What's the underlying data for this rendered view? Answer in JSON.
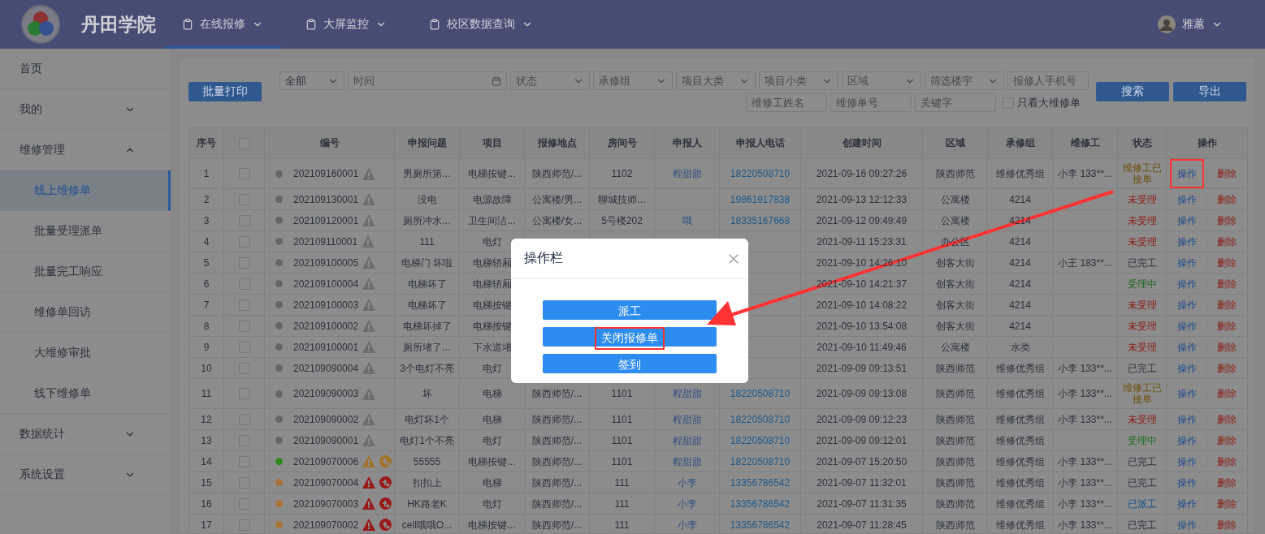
{
  "header": {
    "title": "丹田学院",
    "nav": [
      {
        "label": "在线报修",
        "selected": true
      },
      {
        "label": "大屏监控",
        "selected": false
      },
      {
        "label": "校区数据查询",
        "selected": false
      }
    ],
    "user": "雅蕙"
  },
  "sidebar": [
    {
      "label": "首页",
      "selected": false
    },
    {
      "label": "我的",
      "selected": false,
      "expanded": false
    },
    {
      "label": "维修管理",
      "selected": false,
      "expanded": true,
      "children": [
        {
          "label": "线上维修单",
          "selected": true
        },
        {
          "label": "批量受理派单",
          "selected": false
        },
        {
          "label": "批量完工响应",
          "selected": false
        },
        {
          "label": "维修单回访",
          "selected": false
        },
        {
          "label": "大维修审批",
          "selected": false
        },
        {
          "label": "线下维修单",
          "selected": false
        }
      ]
    },
    {
      "label": "数据统计",
      "selected": false,
      "expanded": false
    },
    {
      "label": "系统设置",
      "selected": false,
      "expanded": false
    }
  ],
  "toolbar": {
    "print_button": "批量打印",
    "filters": [
      {
        "kind": "select",
        "value": "全部"
      },
      {
        "kind": "date",
        "placeholder": "时间"
      },
      {
        "kind": "select",
        "placeholder": "状态"
      },
      {
        "kind": "select",
        "placeholder": "承修组"
      },
      {
        "kind": "select",
        "placeholder": "项目大类"
      },
      {
        "kind": "select",
        "placeholder": "项目小类"
      },
      {
        "kind": "select",
        "placeholder": "区域"
      },
      {
        "kind": "select",
        "placeholder": "筛选楼宇"
      },
      {
        "kind": "input",
        "placeholder": "报修人手机号"
      },
      {
        "kind": "input",
        "placeholder": "维修工姓名"
      },
      {
        "kind": "input",
        "placeholder": "维修单号"
      },
      {
        "kind": "input",
        "placeholder": "关键字"
      },
      {
        "kind": "checkbox",
        "label": "只看大维修单",
        "checked": false
      }
    ],
    "search_button": "搜索",
    "export_button": "导出"
  },
  "table": {
    "columns": [
      {
        "label": "序号"
      },
      {
        "kind": "checkbox",
        "checked": false
      },
      {
        "label": "编号"
      },
      {
        "label": "申报问题"
      },
      {
        "label": "项目"
      },
      {
        "label": "报修地点"
      },
      {
        "label": "房间号"
      },
      {
        "label": "申报人"
      },
      {
        "label": "申报人电话"
      },
      {
        "label": "创建时间"
      },
      {
        "label": "区域"
      },
      {
        "label": "承修组"
      },
      {
        "label": "维修工"
      },
      {
        "label": "状态"
      },
      {
        "label": "操作"
      }
    ],
    "rows": [
      {
        "no": "1",
        "checked": false,
        "dot": {
          "color": "#666666"
        },
        "code": "202109160001",
        "warning": {
          "color": "#6e6e6e"
        },
        "problem": "男厕所第...",
        "project": "电梯按键...",
        "location": "陕西师范/...",
        "room": "1102",
        "reporter": "程甜甜",
        "phone": "18220508710",
        "created": "2021-09-16 09:27:26",
        "area": "陕西师范",
        "group": "维修优秀组",
        "worker": "小李 133**...",
        "status": {
          "label": "维修工已接单",
          "color": "#6e4e0a"
        },
        "action": "操作",
        "action_highlighted": true,
        "delete": "删除"
      },
      {
        "no": "2",
        "checked": false,
        "dot": {
          "color": "#666666"
        },
        "code": "202109130001",
        "warning": {
          "color": "#6e6e6e"
        },
        "problem": "没电",
        "project": "电源故障",
        "location": "公寓楼/男...",
        "room": "聊城技师...",
        "phone": "19861917838",
        "created": "2021-09-13 12:12:33",
        "area": "公寓楼",
        "group": "4214",
        "status": {
          "label": "未受理",
          "color": "#8c1a14"
        },
        "action": "操作",
        "action_highlighted": false,
        "delete": "删除"
      },
      {
        "no": "3",
        "checked": false,
        "dot": {
          "color": "#666666"
        },
        "code": "202109120001",
        "warning": {
          "color": "#6e6e6e"
        },
        "problem": "厕所冲水...",
        "project": "卫生间洁...",
        "location": "公寓楼/女...",
        "room": "5号楼202",
        "reporter": "哦",
        "phone": "18335167668",
        "created": "2021-09-12 09:49:49",
        "area": "公寓楼",
        "group": "4214",
        "status": {
          "label": "未受理",
          "color": "#8c1a14"
        },
        "action": "操作",
        "action_highlighted": false,
        "delete": "删除"
      },
      {
        "no": "4",
        "checked": false,
        "dot": {
          "color": "#666666"
        },
        "code": "202109110001",
        "warning": {
          "color": "#6e6e6e"
        },
        "problem": "111",
        "project": "电灯",
        "created": "2021-09-11 15:23:31",
        "area": "办公区",
        "group": "4214",
        "status": {
          "label": "未受理",
          "color": "#8c1a14"
        },
        "action": "操作",
        "action_highlighted": false,
        "delete": "删除"
      },
      {
        "no": "5",
        "checked": false,
        "dot": {
          "color": "#666666"
        },
        "code": "202109100005",
        "warning": {
          "color": "#6e6e6e"
        },
        "problem": "电梯门 坏啦",
        "project": "电梯轿厢",
        "created": "2021-09-10 14:26:10",
        "area": "创客大街",
        "group": "4214",
        "worker": "小王 183**...",
        "status": {
          "label": "已完工",
          "color": "#2d313c"
        },
        "action": "操作",
        "action_highlighted": false,
        "delete": "删除"
      },
      {
        "no": "6",
        "checked": false,
        "dot": {
          "color": "#666666"
        },
        "code": "202109100004",
        "warning": {
          "color": "#6e6e6e"
        },
        "problem": "电梯坏了",
        "project": "电梯轿厢",
        "created": "2021-09-10 14:21:37",
        "area": "创客大街",
        "group": "4214",
        "status": {
          "label": "受理中",
          "color": "#1f6a1f"
        },
        "action": "操作",
        "action_highlighted": false,
        "delete": "删除"
      },
      {
        "no": "7",
        "checked": false,
        "dot": {
          "color": "#666666"
        },
        "code": "202109100003",
        "warning": {
          "color": "#6e6e6e"
        },
        "problem": "电梯坏了",
        "project": "电梯按键",
        "created": "2021-09-10 14:08:22",
        "area": "创客大街",
        "group": "4214",
        "status": {
          "label": "未受理",
          "color": "#8c1a14"
        },
        "action": "操作",
        "action_highlighted": false,
        "delete": "删除"
      },
      {
        "no": "8",
        "checked": false,
        "dot": {
          "color": "#666666"
        },
        "code": "202109100002",
        "warning": {
          "color": "#6e6e6e"
        },
        "problem": "电梯坏掉了",
        "project": "电梯按键",
        "created": "2021-09-10 13:54:08",
        "area": "创客大街",
        "group": "4214",
        "status": {
          "label": "未受理",
          "color": "#8c1a14"
        },
        "action": "操作",
        "action_highlighted": false,
        "delete": "删除"
      },
      {
        "no": "9",
        "checked": false,
        "dot": {
          "color": "#666666"
        },
        "code": "202109100001",
        "warning": {
          "color": "#6e6e6e"
        },
        "problem": "厕所堵了...",
        "project": "下水道堵",
        "created": "2021-09-10 11:49:46",
        "area": "公寓楼",
        "group": "水类",
        "status": {
          "label": "未受理",
          "color": "#8c1a14"
        },
        "action": "操作",
        "action_highlighted": false,
        "delete": "删除"
      },
      {
        "no": "10",
        "checked": false,
        "dot": {
          "color": "#666666"
        },
        "code": "202109090004",
        "warning": {
          "color": "#6e6e6e"
        },
        "problem": "3个电灯不亮",
        "project": "电灯",
        "created": "2021-09-09 09:13:51",
        "area": "陕西师范",
        "group": "维修优秀组",
        "worker": "小李 133**...",
        "status": {
          "label": "已完工",
          "color": "#2d313c"
        },
        "action": "操作",
        "action_highlighted": false,
        "delete": "删除"
      },
      {
        "no": "11",
        "checked": false,
        "dot": {
          "color": "#666666"
        },
        "code": "202109090003",
        "warning": {
          "color": "#6e6e6e"
        },
        "problem": "坏",
        "project": "电梯",
        "location": "陕西师范/...",
        "room": "1101",
        "reporter": "程甜甜",
        "phone": "18220508710",
        "created": "2021-09-09 09:13:08",
        "area": "陕西师范",
        "group": "维修优秀组",
        "worker": "小李 133**...",
        "status": {
          "label": "维修工已接单",
          "color": "#6e4e0a"
        },
        "action": "操作",
        "action_highlighted": false,
        "delete": "删除"
      },
      {
        "no": "12",
        "checked": false,
        "dot": {
          "color": "#666666"
        },
        "code": "202109090002",
        "warning": {
          "color": "#6e6e6e"
        },
        "problem": "电灯坏1个",
        "project": "电梯",
        "location": "陕西师范/...",
        "room": "1101",
        "reporter": "程甜甜",
        "phone": "18220508710",
        "created": "2021-09-09 09:12:23",
        "area": "陕西师范",
        "group": "维修优秀组",
        "worker": "小李 133**...",
        "status": {
          "label": "未受理",
          "color": "#8c1a14"
        },
        "action": "操作",
        "action_highlighted": false,
        "delete": "删除"
      },
      {
        "no": "13",
        "checked": false,
        "dot": {
          "color": "#666666"
        },
        "code": "202109090001",
        "warning": {
          "color": "#6e6e6e"
        },
        "problem": "电灯1个不亮",
        "project": "电灯",
        "location": "陕西师范/...",
        "room": "1101",
        "reporter": "程甜甜",
        "phone": "18220508710",
        "created": "2021-09-09 09:12:01",
        "area": "陕西师范",
        "group": "维修优秀组",
        "status": {
          "label": "受理中",
          "color": "#1f6a1f"
        },
        "action": "操作",
        "action_highlighted": false,
        "delete": "删除"
      },
      {
        "no": "14",
        "checked": false,
        "dot": {
          "color": "#2f8a1e"
        },
        "code": "202109070006",
        "warning": {
          "color": "#a0742a"
        },
        "badge": {
          "color": "#a0742a"
        },
        "problem": "55555",
        "project": "电梯按键...",
        "location": "陕西师范/...",
        "room": "1101",
        "reporter": "程甜甜",
        "phone": "18220508710",
        "created": "2021-09-07 15:20:50",
        "area": "陕西师范",
        "group": "维修优秀组",
        "worker": "小李 133**...",
        "status": {
          "label": "已完工",
          "color": "#2d313c"
        },
        "action": "操作",
        "action_highlighted": false,
        "delete": "删除"
      },
      {
        "no": "15",
        "checked": false,
        "dot": {
          "color": "#a8743a"
        },
        "code": "202109070004",
        "warning": {
          "color": "#9a1a1a"
        },
        "badge": {
          "color": "#9a1a1a"
        },
        "problem": "扣扣上",
        "project": "电梯",
        "location": "陕西师范/...",
        "room": "111",
        "reporter": "小李",
        "phone": "13356786542",
        "created": "2021-09-07 11:32:01",
        "area": "陕西师范",
        "group": "维修优秀组",
        "worker": "小李 133**...",
        "status": {
          "label": "已完工",
          "color": "#2d313c"
        },
        "action": "操作",
        "action_highlighted": false,
        "delete": "删除"
      },
      {
        "no": "16",
        "checked": false,
        "dot": {
          "color": "#a8743a"
        },
        "code": "202109070003",
        "warning": {
          "color": "#9a1a1a"
        },
        "badge": {
          "color": "#9a1a1a"
        },
        "problem": "HK路老K",
        "project": "电灯",
        "location": "陕西师范/...",
        "room": "111",
        "reporter": "小李",
        "phone": "13356786542",
        "created": "2021-09-07 11:31:35",
        "area": "陕西师范",
        "group": "维修优秀组",
        "worker": "小李 133**...",
        "status": {
          "label": "已派工",
          "color": "#134f8a"
        },
        "action": "操作",
        "action_highlighted": false,
        "delete": "删除"
      },
      {
        "no": "17",
        "checked": false,
        "dot": {
          "color": "#a8743a"
        },
        "code": "202109070002",
        "warning": {
          "color": "#9a1a1a"
        },
        "badge": {
          "color": "#9a1a1a"
        },
        "problem": "cell哦哦O...",
        "project": "电梯按键...",
        "location": "陕西师范/...",
        "room": "111",
        "reporter": "小李",
        "phone": "13356786542",
        "created": "2021-09-07 11:28:45",
        "area": "陕西师范",
        "group": "维修优秀组",
        "worker": "小李 133**...",
        "status": {
          "label": "已完工",
          "color": "#2d313c"
        },
        "action": "操作",
        "action_highlighted": false,
        "delete": "删除"
      }
    ]
  },
  "modal": {
    "title": "操作栏",
    "buttons": [
      {
        "label": "派工",
        "highlighted": false
      },
      {
        "label": "关闭报修单",
        "highlighted": true
      },
      {
        "label": "签到",
        "highlighted": false
      }
    ]
  }
}
